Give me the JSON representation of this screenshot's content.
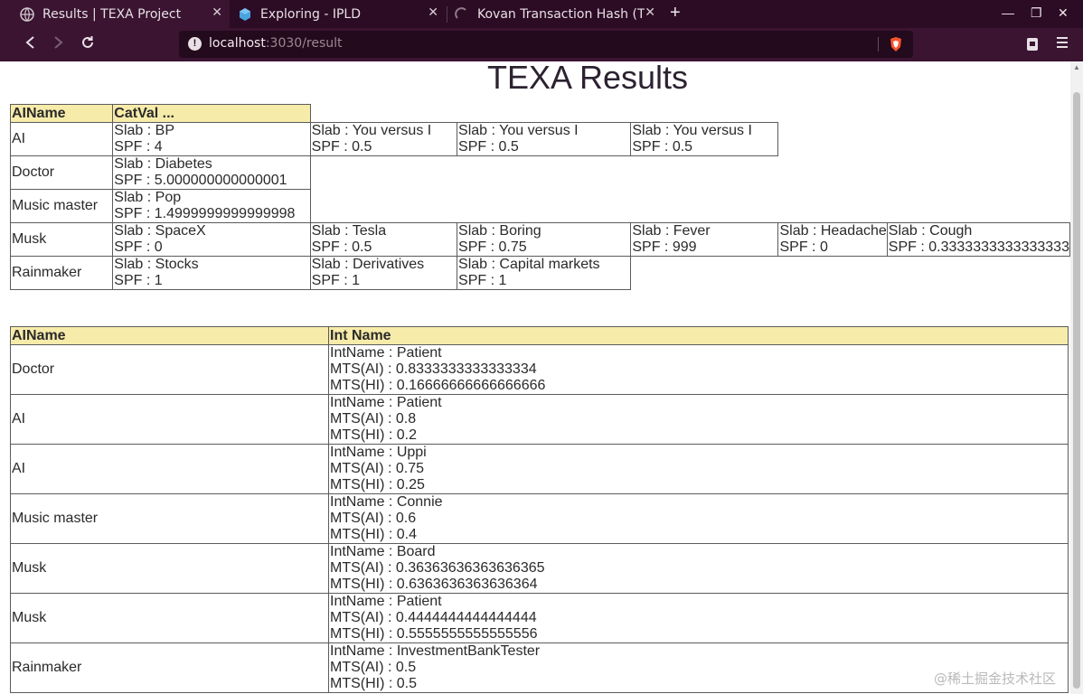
{
  "browser": {
    "tabs": [
      {
        "title": "Results | TEXA Project",
        "active": true,
        "icon": "globe-icon"
      },
      {
        "title": "Exploring - IPLD",
        "active": false,
        "icon": "ipld-cube-icon"
      },
      {
        "title": "Kovan Transaction Hash (T",
        "active": false,
        "icon": "loading-spinner-icon"
      }
    ],
    "new_tab_label": "+",
    "url_host": "localhost",
    "url_rest": ":3030/result"
  },
  "page": {
    "title": "TEXA Results",
    "cat_table": {
      "headers": [
        "AIName",
        "CatVal ..."
      ],
      "slab_label": "Slab : ",
      "spf_label": "SPF : ",
      "rows": [
        {
          "name": "AI",
          "slabs": [
            {
              "slab": "BP",
              "spf": "4"
            },
            {
              "slab": "You versus I",
              "spf": "0.5"
            },
            {
              "slab": "You versus I",
              "spf": "0.5"
            },
            {
              "slab": "You versus I",
              "spf": "0.5"
            }
          ]
        },
        {
          "name": "Doctor",
          "slabs": [
            {
              "slab": "Diabetes",
              "spf": "5.000000000000001"
            }
          ]
        },
        {
          "name": "Music master",
          "slabs": [
            {
              "slab": "Pop",
              "spf": "1.4999999999999998"
            }
          ]
        },
        {
          "name": "Musk",
          "slabs": [
            {
              "slab": "SpaceX",
              "spf": "0"
            },
            {
              "slab": "Tesla",
              "spf": "0.5"
            },
            {
              "slab": "Boring",
              "spf": "0.75"
            },
            {
              "slab": "Fever",
              "spf": "999"
            },
            {
              "slab": "Headache",
              "spf": "0"
            },
            {
              "slab": "Cough",
              "spf": "0.3333333333333333"
            }
          ]
        },
        {
          "name": "Rainmaker",
          "slabs": [
            {
              "slab": "Stocks",
              "spf": "1"
            },
            {
              "slab": "Derivatives",
              "spf": "1"
            },
            {
              "slab": "Capital markets",
              "spf": "1"
            }
          ]
        }
      ]
    },
    "int_table": {
      "headers": [
        "AIName",
        "Int Name"
      ],
      "intname_label": "IntName : ",
      "mts_ai_label": "MTS(AI) : ",
      "mts_hi_label": "MTS(HI) : ",
      "rows": [
        {
          "name": "Doctor",
          "intname": "Patient",
          "mts_ai": "0.8333333333333334",
          "mts_hi": "0.16666666666666666"
        },
        {
          "name": "AI",
          "intname": "Patient",
          "mts_ai": "0.8",
          "mts_hi": "0.2"
        },
        {
          "name": "AI",
          "intname": "Uppi",
          "mts_ai": "0.75",
          "mts_hi": "0.25"
        },
        {
          "name": "Music master",
          "intname": "Connie",
          "mts_ai": "0.6",
          "mts_hi": "0.4"
        },
        {
          "name": "Musk",
          "intname": "Board",
          "mts_ai": "0.36363636363636365",
          "mts_hi": "0.6363636363636364"
        },
        {
          "name": "Musk",
          "intname": "Patient",
          "mts_ai": "0.4444444444444444",
          "mts_hi": "0.5555555555555556"
        },
        {
          "name": "Rainmaker",
          "intname": "InvestmentBankTester",
          "mts_ai": "0.5",
          "mts_hi": "0.5"
        }
      ]
    }
  },
  "watermark": "@稀土掘金技术社区"
}
